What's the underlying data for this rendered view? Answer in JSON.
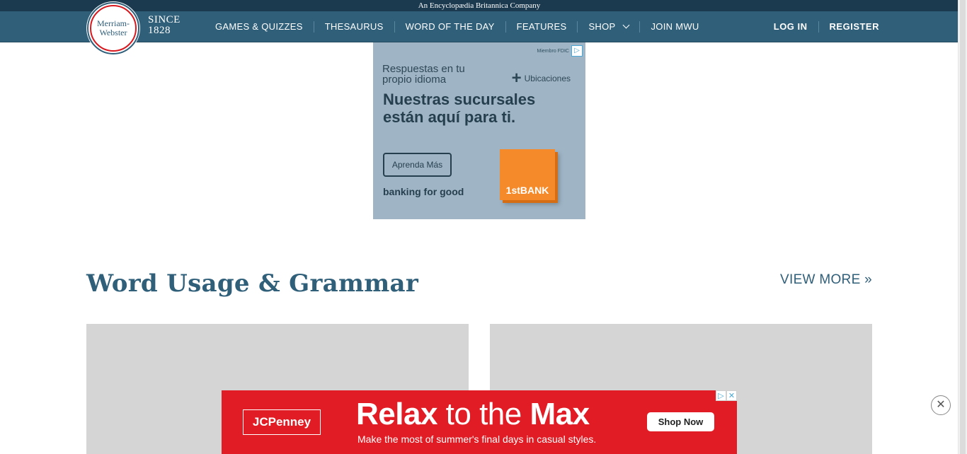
{
  "top_strip": {
    "text": "An Encyclopædia Britannica Company"
  },
  "logo": {
    "line1": "Merriam-",
    "line2": "Webster",
    "since": "SINCE",
    "year": "1828"
  },
  "nav": {
    "items": [
      {
        "label": "GAMES & QUIZZES"
      },
      {
        "label": "THESAURUS"
      },
      {
        "label": "WORD OF THE DAY"
      },
      {
        "label": "FEATURES"
      },
      {
        "label": "SHOP"
      },
      {
        "label": "JOIN MWU"
      }
    ],
    "login": "LOG IN",
    "register": "REGISTER"
  },
  "ad_top": {
    "fdic": "Miembro FDIC",
    "subhead": "Respuestas en tu propio idioma",
    "locations": "Ubicaciones",
    "headline": "Nuestras sucursales están aquí para ti.",
    "button": "Aprenda Más",
    "tagline": "banking for good",
    "brand": "1stBANK"
  },
  "section": {
    "title": "Word Usage & Grammar",
    "view_more": "VIEW MORE »"
  },
  "ad_bottom": {
    "brand": "JCPenney",
    "headline_bold1": "Relax",
    "headline_mid": " to the ",
    "headline_bold2": "Max",
    "subline": "Make the most of summer's final days in casual styles.",
    "button": "Shop Now"
  },
  "colors": {
    "brand_blue": "#305f7a",
    "dark_strip": "#1b3a4f",
    "ad_red": "#e21c24",
    "card_gray": "#d6d5d6"
  }
}
